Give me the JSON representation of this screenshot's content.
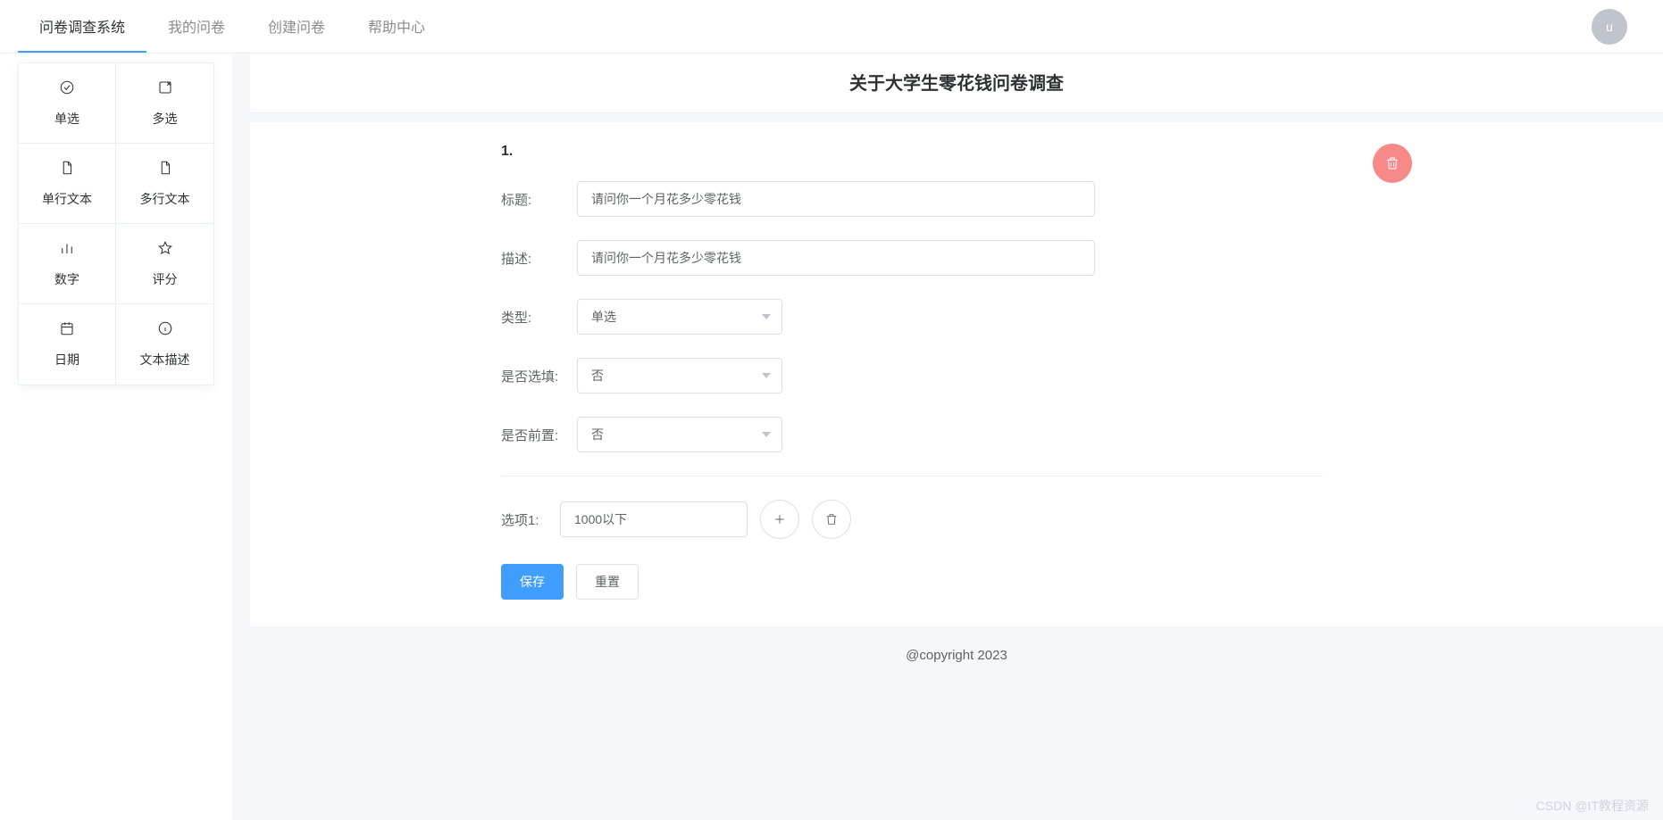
{
  "header": {
    "nav": [
      "问卷调查系统",
      "我的问卷",
      "创建问卷",
      "帮助中心"
    ],
    "active_index": 0,
    "avatar_letter": "u"
  },
  "palette": [
    {
      "id": "radio",
      "label": "单选",
      "icon": "radio-icon"
    },
    {
      "id": "checkbox",
      "label": "多选",
      "icon": "checkbox-icon"
    },
    {
      "id": "text1",
      "label": "单行文本",
      "icon": "file-icon"
    },
    {
      "id": "textn",
      "label": "多行文本",
      "icon": "file-icon"
    },
    {
      "id": "number",
      "label": "数字",
      "icon": "bar-chart-icon"
    },
    {
      "id": "rate",
      "label": "评分",
      "icon": "star-icon"
    },
    {
      "id": "date",
      "label": "日期",
      "icon": "calendar-icon"
    },
    {
      "id": "desc",
      "label": "文本描述",
      "icon": "info-icon"
    }
  ],
  "survey": {
    "title": "关于大学生零花钱问卷调查"
  },
  "question": {
    "number": "1.",
    "fields": {
      "title_label": "标题:",
      "title_value": "请问你一个月花多少零花钱",
      "desc_label": "描述:",
      "desc_value": "请问你一个月花多少零花钱",
      "type_label": "类型:",
      "type_value": "单选",
      "required_label": "是否选填:",
      "required_value": "否",
      "prefix_label": "是否前置:",
      "prefix_value": "否"
    },
    "option": {
      "label": "选项1:",
      "value": "1000以下"
    },
    "buttons": {
      "save": "保存",
      "reset": "重置"
    }
  },
  "footer": "@copyright 2023",
  "watermark": "CSDN @IT教程资源"
}
